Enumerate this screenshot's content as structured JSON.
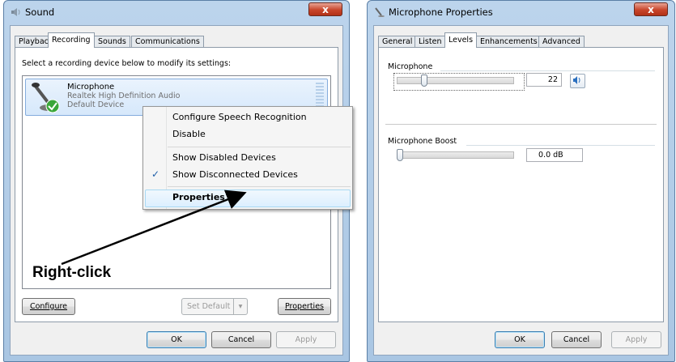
{
  "sound_window": {
    "title": "Sound",
    "close": "x",
    "tabs": [
      "Playback",
      "Recording",
      "Sounds",
      "Communications"
    ],
    "active_tab": "Recording",
    "instruction": "Select a recording device below to modify its settings:",
    "device": {
      "name": "Microphone",
      "driver": "Realtek High Definition Audio",
      "status": "Default Device"
    },
    "buttons": {
      "configure": "Configure",
      "set_default": "Set Default",
      "properties": "Properties",
      "ok": "OK",
      "cancel": "Cancel",
      "apply": "Apply"
    }
  },
  "context_menu": {
    "items": [
      "Configure Speech Recognition",
      "Disable",
      "Show Disabled Devices",
      "Show Disconnected Devices",
      "Properties"
    ],
    "checked_item": "Show Disconnected Devices",
    "highlighted_item": "Properties"
  },
  "annotation": {
    "label": "Right-click"
  },
  "mic_window": {
    "title": "Microphone Properties",
    "close": "x",
    "tabs": [
      "General",
      "Listen",
      "Levels",
      "Enhancements",
      "Advanced"
    ],
    "active_tab": "Levels",
    "microphone": {
      "label": "Microphone",
      "value": "22",
      "level_fraction": 0.22
    },
    "boost": {
      "label": "Microphone Boost",
      "value": "0.0 dB",
      "level_fraction": 0
    },
    "buttons": {
      "ok": "OK",
      "cancel": "Cancel",
      "apply": "Apply"
    }
  },
  "colors": {
    "title_blue": "#a9c6e3",
    "close_red": "#c8452b",
    "selection_blue": "#d6e8fb",
    "check_green": "#3aa63a"
  }
}
